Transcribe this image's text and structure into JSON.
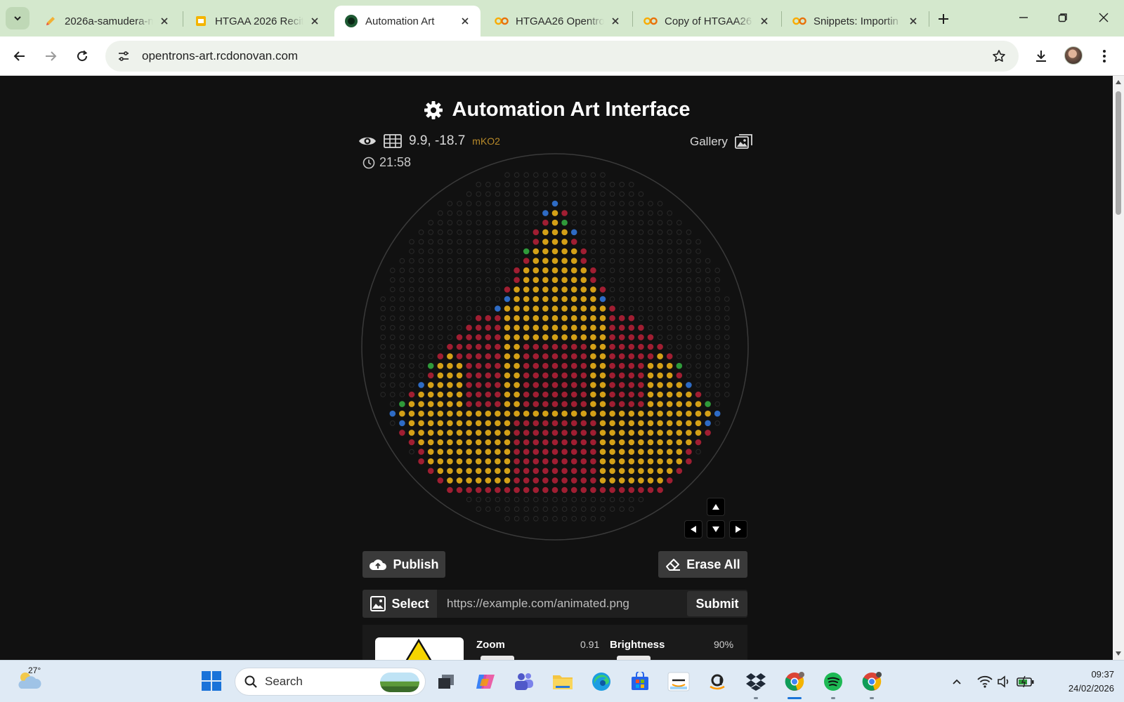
{
  "browser": {
    "tabs": [
      {
        "title": "2026a-samudera-n",
        "favicon": "pencil-icon",
        "active": false
      },
      {
        "title": "HTGAA 2026 Recita",
        "favicon": "slides-icon",
        "active": false
      },
      {
        "title": "Automation Art",
        "favicon": "automation-art-icon",
        "active": true
      },
      {
        "title": "HTGAA26 Opentro",
        "favicon": "colab-icon",
        "active": false
      },
      {
        "title": "Copy of HTGAA26",
        "favicon": "colab-icon",
        "active": false
      },
      {
        "title": "Snippets: Importin",
        "favicon": "colab-icon",
        "active": false
      }
    ],
    "url": "opentrons-art.rcdonovan.com"
  },
  "page": {
    "title": "Automation Art Interface",
    "coords": "9.9, -18.7",
    "plate_name": "mKO2",
    "time": "21:58",
    "gallery_label": "Gallery",
    "publish_label": "Publish",
    "erase_label": "Erase All",
    "select_label": "Select",
    "url_placeholder": "https://example.com/animated.png",
    "submit_label": "Submit",
    "zoom_label": "Zoom",
    "zoom_value": "0.91",
    "brightness_label": "Brightness",
    "brightness_value": "90%"
  },
  "colors": {
    "gold": "#d4a017",
    "red": "#a01e32",
    "blue": "#2e6bc4",
    "green": "#2f9a3a",
    "empty_well": "#2a2a2a"
  },
  "taskbar": {
    "weather_temp": "27°",
    "search_label": "Search",
    "time": "09:37",
    "date": "24/02/2026"
  }
}
